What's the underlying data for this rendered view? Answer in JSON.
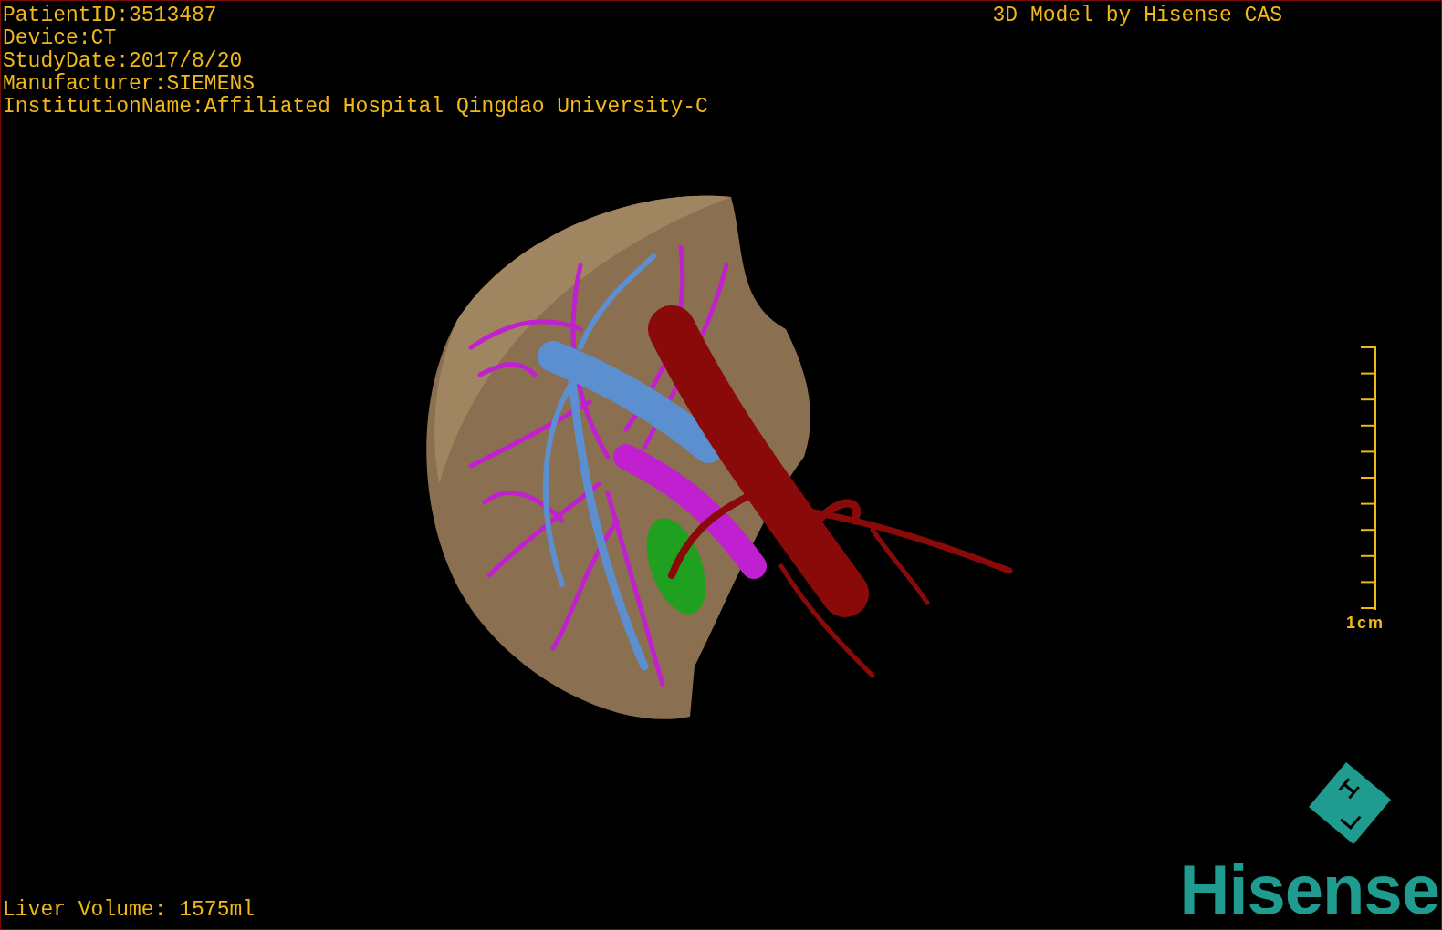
{
  "info_lines": [
    "PatientID:3513487",
    "Device:CT",
    "StudyDate:2017/8/20",
    "Manufacturer:SIEMENS",
    "InstitutionName:Affiliated Hospital Qingdao University-C"
  ],
  "title": "3D Model by Hisense CAS",
  "scale_bar": {
    "label": "1cm"
  },
  "liver_volume": "Liver Volume: 1575ml",
  "logo": {
    "text": "Hisense"
  }
}
